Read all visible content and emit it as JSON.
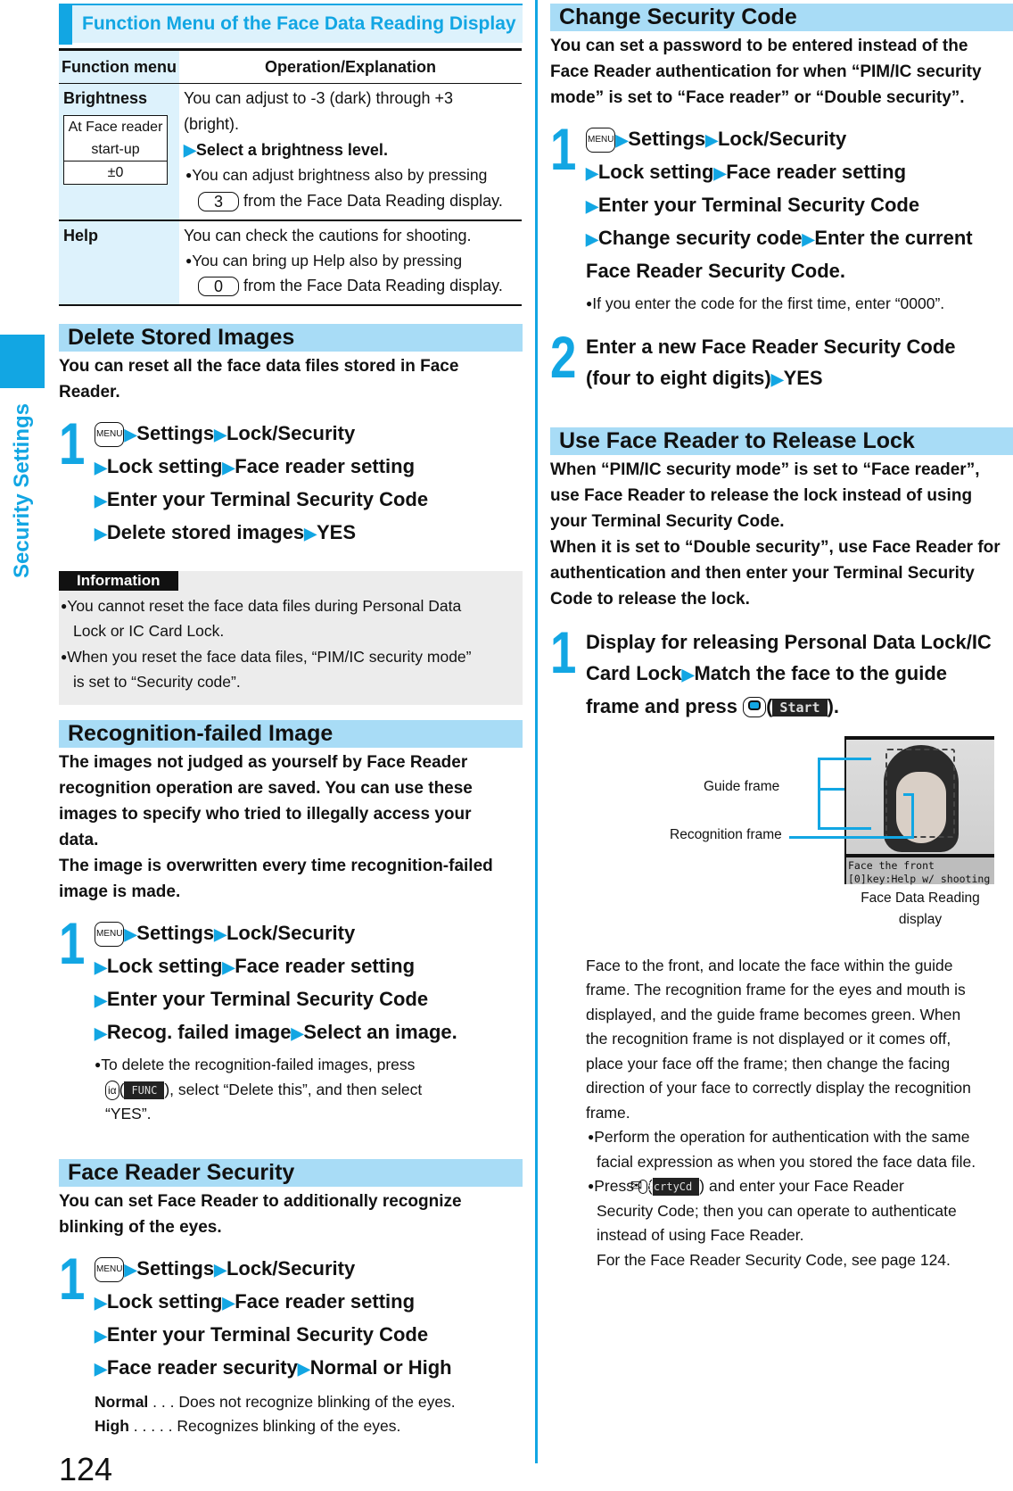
{
  "side_tab": {
    "label": "Security Settings",
    "accent": "#12a6e3"
  },
  "page_number": "124",
  "function_menu": {
    "title": "Function Menu of the Face Data Reading Display",
    "columns": [
      "Function menu",
      "Operation/Explanation"
    ],
    "rows": [
      {
        "name": "Brightness",
        "default_label_1": "At Face reader",
        "default_label_2": "start-up",
        "default_value": "±0",
        "text_1": "You can adjust to -3 (dark) through +3",
        "text_2": "(bright).",
        "action": "Select a brightness level.",
        "note_a": "You can adjust brightness also by pressing",
        "note_key": "3",
        "note_b": "from the Face Data Reading display."
      },
      {
        "name": "Help",
        "text_1": "You can check the cautions for shooting.",
        "note_a": "You can bring up Help also by pressing",
        "note_key": "0",
        "note_b": "from the Face Data Reading display."
      }
    ]
  },
  "common_path": {
    "menu_key": "MENU",
    "settings": "Settings",
    "lock_security": "Lock/Security",
    "lock_setting": "Lock setting",
    "face_reader_setting": "Face reader setting",
    "enter_code": "Enter your Terminal Security Code"
  },
  "delete_stored": {
    "title": "Delete Stored Images",
    "intro_1": "You can reset all the face data files stored in Face",
    "intro_2": "Reader.",
    "step_num": "1",
    "final_a": "Delete stored images",
    "final_b": "YES",
    "info_label": "Information",
    "info_1a": "You cannot reset the face data files during Personal Data",
    "info_1b": "Lock or IC Card Lock.",
    "info_2a": "When you reset the face data files, “PIM/IC security mode”",
    "info_2b": "is set to “Security code”."
  },
  "recog_failed": {
    "title": "Recognition-failed Image",
    "intro": [
      "The images not judged as yourself by Face Reader",
      "recognition operation are saved. You can use these",
      "images to specify who tried to illegally access your",
      "data.",
      "The image is overwritten every time recognition-failed",
      "image is made."
    ],
    "step_num": "1",
    "final_a": "Recog. failed image",
    "final_b": "Select an image.",
    "note_1": "To delete the recognition-failed images, press",
    "note_key": "iα",
    "note_btn": "FUNC",
    "note_2": "), select “Delete this”, and then select",
    "note_3": "“YES”."
  },
  "face_security": {
    "title": "Face Reader Security",
    "intro_1": "You can set Face Reader to additionally recognize",
    "intro_2": "blinking of the eyes.",
    "step_num": "1",
    "final_a": "Face reader security",
    "final_b": "Normal or High",
    "options": [
      {
        "name": "Normal",
        "dots": " . . . ",
        "desc": "Does not recognize blinking of the eyes."
      },
      {
        "name": "High",
        "dots": " . . . . . ",
        "desc": "Recognizes blinking of the eyes."
      }
    ]
  },
  "change_code": {
    "title": "Change Security Code",
    "intro": [
      "You can set a password to be entered instead of the",
      "Face Reader authentication for when “PIM/IC security",
      "mode” is set to “Face reader” or “Double security”."
    ],
    "step1_num": "1",
    "final_a": "Change security code",
    "final_b": "Enter the current",
    "final_c": "Face Reader Security Code.",
    "note": "If you enter the code for the first time, enter “0000”.",
    "step2_num": "2",
    "step2_a": "Enter a new Face Reader Security Code",
    "step2_b": "(four to eight digits)",
    "step2_c": "YES"
  },
  "release_lock": {
    "title": "Use Face Reader to Release Lock",
    "intro": [
      "When “PIM/IC security mode” is set to “Face reader”,",
      "use Face Reader to release the lock instead of using",
      "your Terminal Security Code.",
      "When it is set to “Double security”, use Face Reader for",
      "authentication and then enter your Terminal Security",
      "Code to release the lock."
    ],
    "step_num": "1",
    "step_a": "Display for releasing Personal Data Lock/IC",
    "step_b1": "Card Lock",
    "step_b2": "Match the face to the guide",
    "step_c": "frame and press",
    "step_btn": "Start",
    "figure": {
      "guide_label": "Guide frame",
      "recog_label": "Recognition frame",
      "screen_text": "Face the front\n[0]key:Help w/ shooting",
      "caption_1": "Face Data Reading",
      "caption_2": "display"
    },
    "body": [
      "Face to the front, and locate the face within the guide",
      "frame. The recognition frame for the eyes and mouth is",
      "displayed, and the guide frame becomes green. When",
      "the recognition frame is not displayed or it comes off,",
      "place your face off the frame; then change the facing",
      "direction of your face to correctly display the recognition",
      "frame."
    ],
    "note_1a": "Perform the operation for authentication with the same",
    "note_1b": "facial expression as when you stored the face data file.",
    "note_2_pre": "Press",
    "note_2_btn": "ScrtyCd",
    "note_2_post": ") and enter your Face Reader",
    "note_2b": "Security Code; then you can operate to authenticate",
    "note_2c": "instead of using Face Reader.",
    "note_2d": "For the Face Reader Security Code, see page 124."
  }
}
